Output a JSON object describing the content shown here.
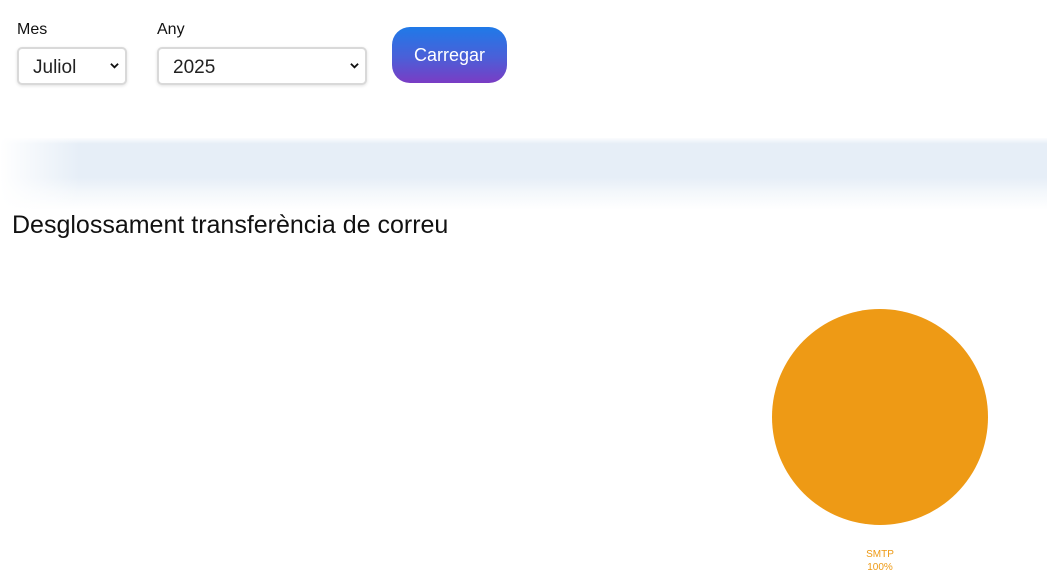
{
  "filters": {
    "month": {
      "label": "Mes",
      "value": "Juliol"
    },
    "year": {
      "label": "Any",
      "value": "2025"
    },
    "load_button_label": "Carregar"
  },
  "section": {
    "title": "Desglossament transferència de correu"
  },
  "colors": {
    "slice_smtp": "#ee9a15",
    "button_gradient_top": "#1f7ae8",
    "button_gradient_bottom": "#7a3cc4"
  },
  "chart_data": {
    "type": "pie",
    "title": "",
    "slices": [
      {
        "label": "SMTP",
        "value": 100,
        "display": "100%",
        "color": "#ee9a15"
      }
    ]
  }
}
